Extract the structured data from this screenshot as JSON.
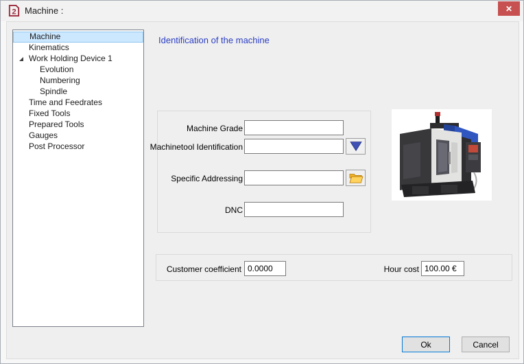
{
  "window": {
    "title": "Machine :",
    "close_glyph": "✕"
  },
  "sidebar": {
    "items": [
      {
        "label": "Machine",
        "level": 0,
        "selected": true
      },
      {
        "label": "Kinematics",
        "level": 0,
        "selected": false
      },
      {
        "label": "Work Holding Device 1",
        "level": 0,
        "selected": false,
        "expanded": true
      },
      {
        "label": "Evolution",
        "level": 1,
        "selected": false
      },
      {
        "label": "Numbering",
        "level": 1,
        "selected": false
      },
      {
        "label": "Spindle",
        "level": 1,
        "selected": false
      },
      {
        "label": "Time and Feedrates",
        "level": 0,
        "selected": false
      },
      {
        "label": "Fixed Tools",
        "level": 0,
        "selected": false
      },
      {
        "label": "Prepared Tools",
        "level": 0,
        "selected": false
      },
      {
        "label": "Gauges",
        "level": 0,
        "selected": false
      },
      {
        "label": "Post Processor",
        "level": 0,
        "selected": false
      }
    ]
  },
  "main": {
    "heading": "Identification of the machine",
    "identification": {
      "machine_grade": {
        "label": "Machine Grade",
        "value": ""
      },
      "machinetool_identification": {
        "label": "Machinetool Identification",
        "value": "",
        "button_icon": "triangle-down-icon"
      },
      "specific_addressing": {
        "label": "Specific Addressing",
        "value": "",
        "button_icon": "open-folder-icon"
      },
      "dnc": {
        "label": "DNC",
        "value": ""
      }
    },
    "costs": {
      "customer_coefficient": {
        "label": "Customer coefficient",
        "value": "0.0000"
      },
      "hour_cost": {
        "label": "Hour cost",
        "value": "100.00 €"
      }
    },
    "machine_photo_icon": "cnc-machining-center-photo"
  },
  "footer": {
    "ok_label": "Ok",
    "cancel_label": "Cancel"
  },
  "colors": {
    "close_button": "#c75050",
    "heading_blue": "#2b3ec4",
    "selection_bg": "#cce8ff",
    "selection_border": "#8fc6ee",
    "dropdown_triangle": "#3f51b5",
    "folder_gold": "#f7c64a",
    "logo_maroon": "#9c2a3c"
  }
}
